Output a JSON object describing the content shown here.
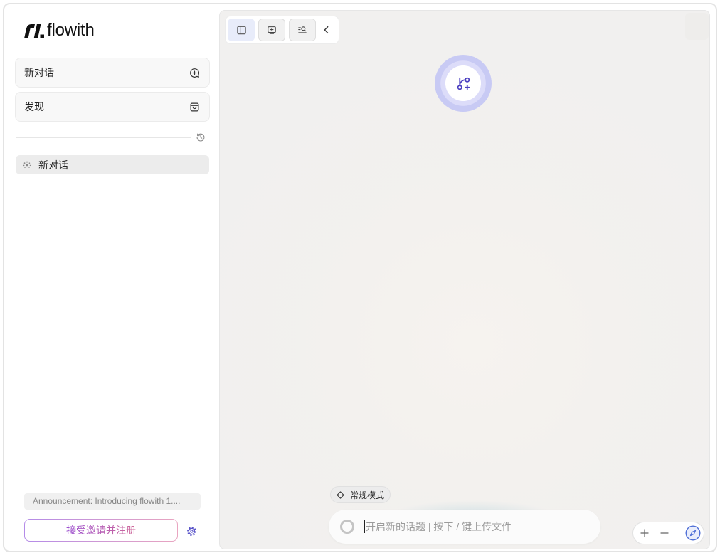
{
  "app": {
    "logo_text": "flowith"
  },
  "sidebar": {
    "new_chat": {
      "label": "新对话",
      "icon": "chat-plus-icon"
    },
    "discover": {
      "label": "发现",
      "icon": "bag-icon"
    },
    "history_icon": "history-icon",
    "history": [
      {
        "label": "新对话",
        "icon": "loading-dots-icon",
        "active": true
      }
    ],
    "announcement": "Announcement: Introducing flowith 1....",
    "invite_label": "接受邀请并注册",
    "settings_icon": "gear-icon"
  },
  "canvas": {
    "toolbar": [
      {
        "icon": "sidebar-panel-icon",
        "active": true
      },
      {
        "icon": "add-box-icon",
        "active": false
      },
      {
        "icon": "search-list-icon",
        "active": false
      },
      {
        "icon": "chevron-left-icon",
        "active": false
      }
    ],
    "center_node": {
      "icon": "branch-plus-icon"
    },
    "zoom_controls": [
      "zoom-in-icon",
      "zoom-out-icon",
      "compass-icon"
    ]
  },
  "composer": {
    "mode_label": "常规模式",
    "mode_icon": "diamond-icon",
    "attach_icon": "ring-icon",
    "placeholder": "开启新的话题 | 按下 / 键上传文件"
  },
  "colors": {
    "accent": "#4b3fc0",
    "node_halo": "#c8caf4",
    "toolbar_active_bg": "#e8ecfa",
    "invite_gradient_start": "#b48be8",
    "invite_gradient_end": "#e9a5c0",
    "compass": "#4f6fd6",
    "settings_icon": "#5a55c9"
  }
}
